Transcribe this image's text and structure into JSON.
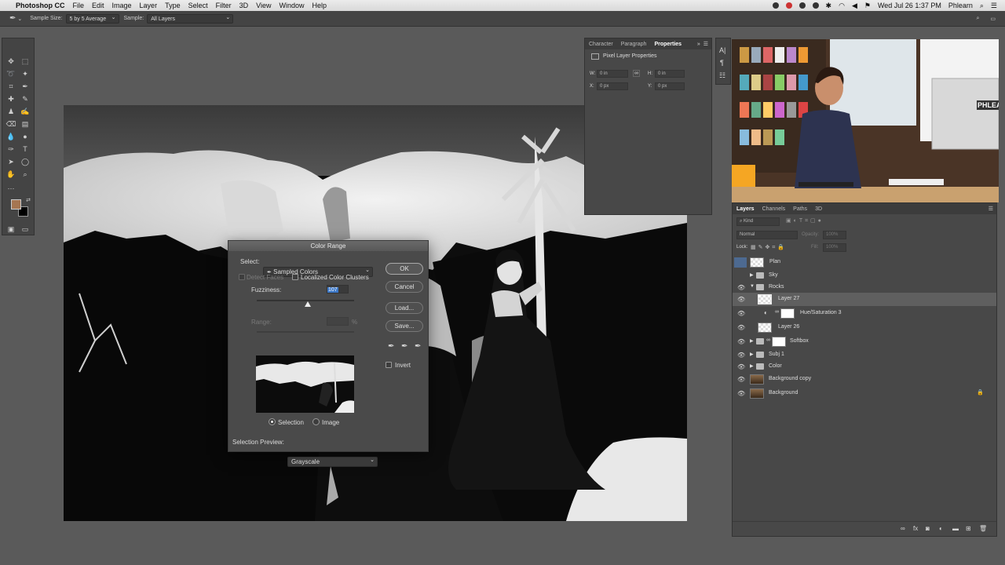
{
  "menubar": {
    "app": "Photoshop CC",
    "items": [
      "File",
      "Edit",
      "Image",
      "Layer",
      "Type",
      "Select",
      "Filter",
      "3D",
      "View",
      "Window",
      "Help"
    ],
    "clock": "Wed Jul 26  1:37 PM",
    "user": "Phlearn"
  },
  "options": {
    "sample_size_label": "Sample Size:",
    "sample_size_value": "5 by 5 Average",
    "sample_label": "Sample:",
    "sample_value": "All Layers"
  },
  "dialog": {
    "title": "Color Range",
    "select_label": "Select:",
    "select_value": "Sampled Colors",
    "detect_faces": "Detect Faces",
    "localized": "Localized Color Clusters",
    "fuzziness_label": "Fuzziness:",
    "fuzziness_value": "107",
    "range_label": "Range:",
    "range_unit": "%",
    "ok": "OK",
    "cancel": "Cancel",
    "load": "Load...",
    "save": "Save...",
    "invert": "Invert",
    "radio_selection": "Selection",
    "radio_image": "Image",
    "preview_label": "Selection Preview:",
    "preview_value": "Grayscale"
  },
  "properties": {
    "tabs": [
      "Character",
      "Paragraph",
      "Properties"
    ],
    "title": "Pixel Layer Properties",
    "w_label": "W:",
    "w_value": "0 in",
    "h_label": "H:",
    "h_value": "0 in",
    "x_label": "X:",
    "x_value": "0 px",
    "y_label": "Y:",
    "y_value": "0 px"
  },
  "layers_panel": {
    "tabs": [
      "Layers",
      "Channels",
      "Paths",
      "3D"
    ],
    "kind_placeholder": "Kind",
    "blend_mode": "Normal",
    "opacity_label": "Opacity:",
    "opacity_value": "100%",
    "lock_label": "Lock:",
    "fill_label": "Fill:",
    "fill_value": "100%",
    "layers": [
      {
        "name": "Plan"
      },
      {
        "name": "Sky"
      },
      {
        "name": "Rocks"
      },
      {
        "name": "Layer 27"
      },
      {
        "name": "Hue/Saturation 3"
      },
      {
        "name": "Layer 26"
      },
      {
        "name": "Softbox"
      },
      {
        "name": "Subj 1"
      },
      {
        "name": "Color"
      },
      {
        "name": "Background copy"
      },
      {
        "name": "Background"
      }
    ]
  },
  "colors": {
    "foreground": "#a67652",
    "background": "#000000"
  },
  "video": {
    "sign_text": "PHLEA"
  }
}
